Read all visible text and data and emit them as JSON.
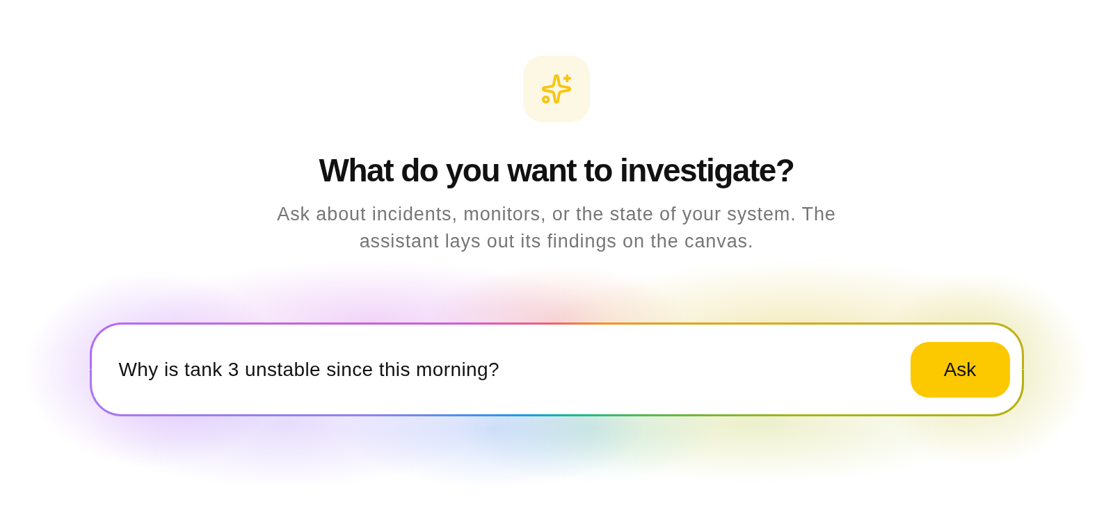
{
  "heading": "What do you want to investigate?",
  "subtitle": "Ask about incidents, monitors, or the state of your system. The assistant lays out its findings on the canvas.",
  "query": {
    "value": "Why is tank 3 unstable since this morning?"
  },
  "ask_button": {
    "label": "Ask"
  }
}
